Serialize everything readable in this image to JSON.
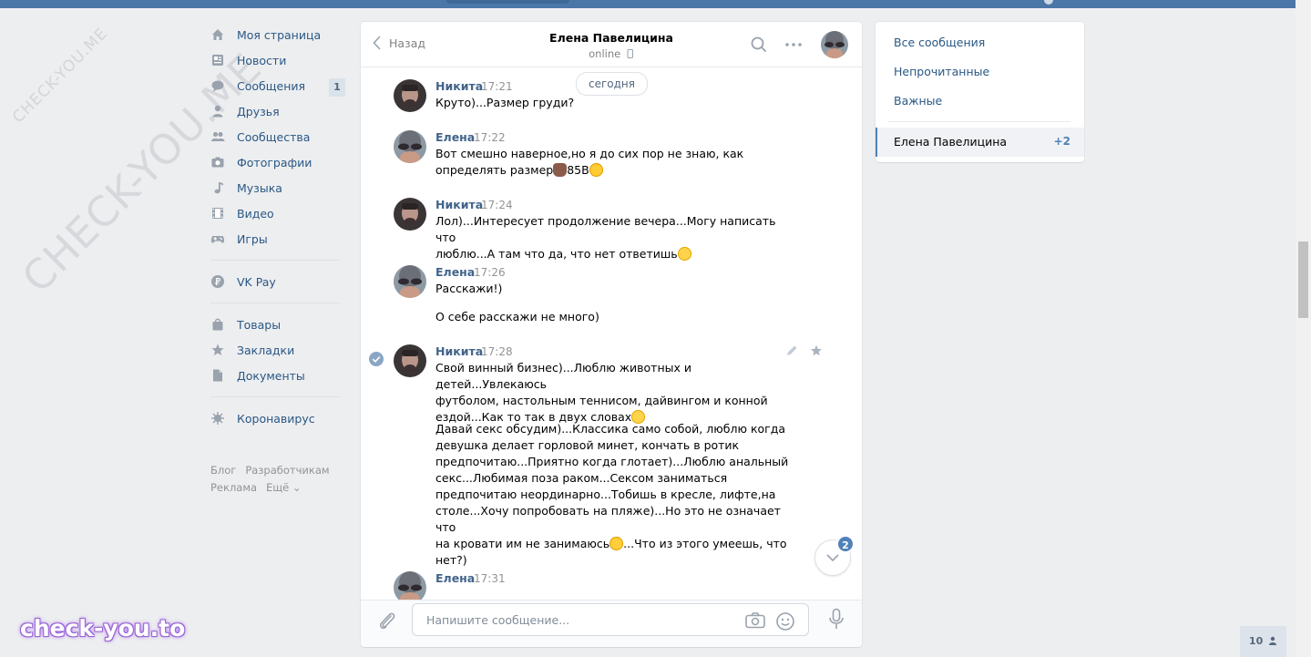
{
  "watermark": {
    "small": "CHECK-YOU.ME",
    "large": "CHECK-YOU.ME",
    "brand": "check-you.to"
  },
  "nav": {
    "items": [
      {
        "label": "Моя страница",
        "icon": "home-icon"
      },
      {
        "label": "Новости",
        "icon": "news-icon"
      },
      {
        "label": "Сообщения",
        "icon": "messages-icon",
        "badge": "1"
      },
      {
        "label": "Друзья",
        "icon": "user-icon"
      },
      {
        "label": "Сообщества",
        "icon": "users-icon"
      },
      {
        "label": "Фотографии",
        "icon": "camera-icon"
      },
      {
        "label": "Музыка",
        "icon": "music-icon"
      },
      {
        "label": "Видео",
        "icon": "video-icon"
      },
      {
        "label": "Игры",
        "icon": "gamepad-icon"
      },
      {
        "label": "VK Pay",
        "icon": "vkpay-icon"
      },
      {
        "label": "Товары",
        "icon": "bag-icon"
      },
      {
        "label": "Закладки",
        "icon": "star-icon"
      },
      {
        "label": "Документы",
        "icon": "document-icon"
      },
      {
        "label": "Коронавирус",
        "icon": "virus-icon"
      }
    ],
    "footer": [
      "Блог",
      "Разработчикам",
      "Реклама",
      "Ещё ⌄"
    ]
  },
  "chat": {
    "back_label": "Назад",
    "peer_name": "Елена Павелицина",
    "peer_status": "online",
    "date_label": "сегодня",
    "messages": [
      {
        "author": "Никита",
        "time": "17:21",
        "text": "Круто)...Размер груди?"
      },
      {
        "author": "Елена",
        "time": "17:22",
        "text": "Вот смешно наверное,но я до сих пор не знаю, как\nопределять размер",
        "text_after": "85В"
      },
      {
        "author": "Никита",
        "time": "17:24",
        "text": "Лол)...Интересует продолжение вечера...Могу написать что\nлюблю...А там что да, что нет ответишь"
      },
      {
        "author": "Елена",
        "time": "17:26",
        "text": "Расскажи!)",
        "text2": "О себе расскажи не много)"
      },
      {
        "author": "Никита",
        "time": "17:28",
        "text": "Свой винный бизнес)...Люблю животных и детей...Увлекаюсь\nфутболом, настольным теннисом, дайвингом и конной\nездой...Как то так в двух словах",
        "text2": "Давай секс обсудим)...Классика само собой, люблю когда\nдевушка делает горловой минет, кончать в ротик\nпредпочитаю...Приятно когда глотает)...Люблю анальный\nсекс...Любимая поза раком...Сексом заниматься\nпредпочитаю неординарно...Тобишь в кресле, лифте,на\nстоле...Хочу попробовать на пляже)...Но это не означает что\nна кровати им не занимаюсь",
        "text2_after": "...Что из этого умеешь, что\nнет?)"
      },
      {
        "author": "Елена",
        "time": "17:31",
        "text": ""
      }
    ],
    "unread_badge": "2",
    "composer_placeholder": "Напишите сообщение..."
  },
  "right_panel": {
    "items": [
      "Все сообщения",
      "Непрочитанные",
      "Важные"
    ],
    "active_name": "Елена Павелицина",
    "active_count": "+2"
  },
  "online_counter": "10"
}
